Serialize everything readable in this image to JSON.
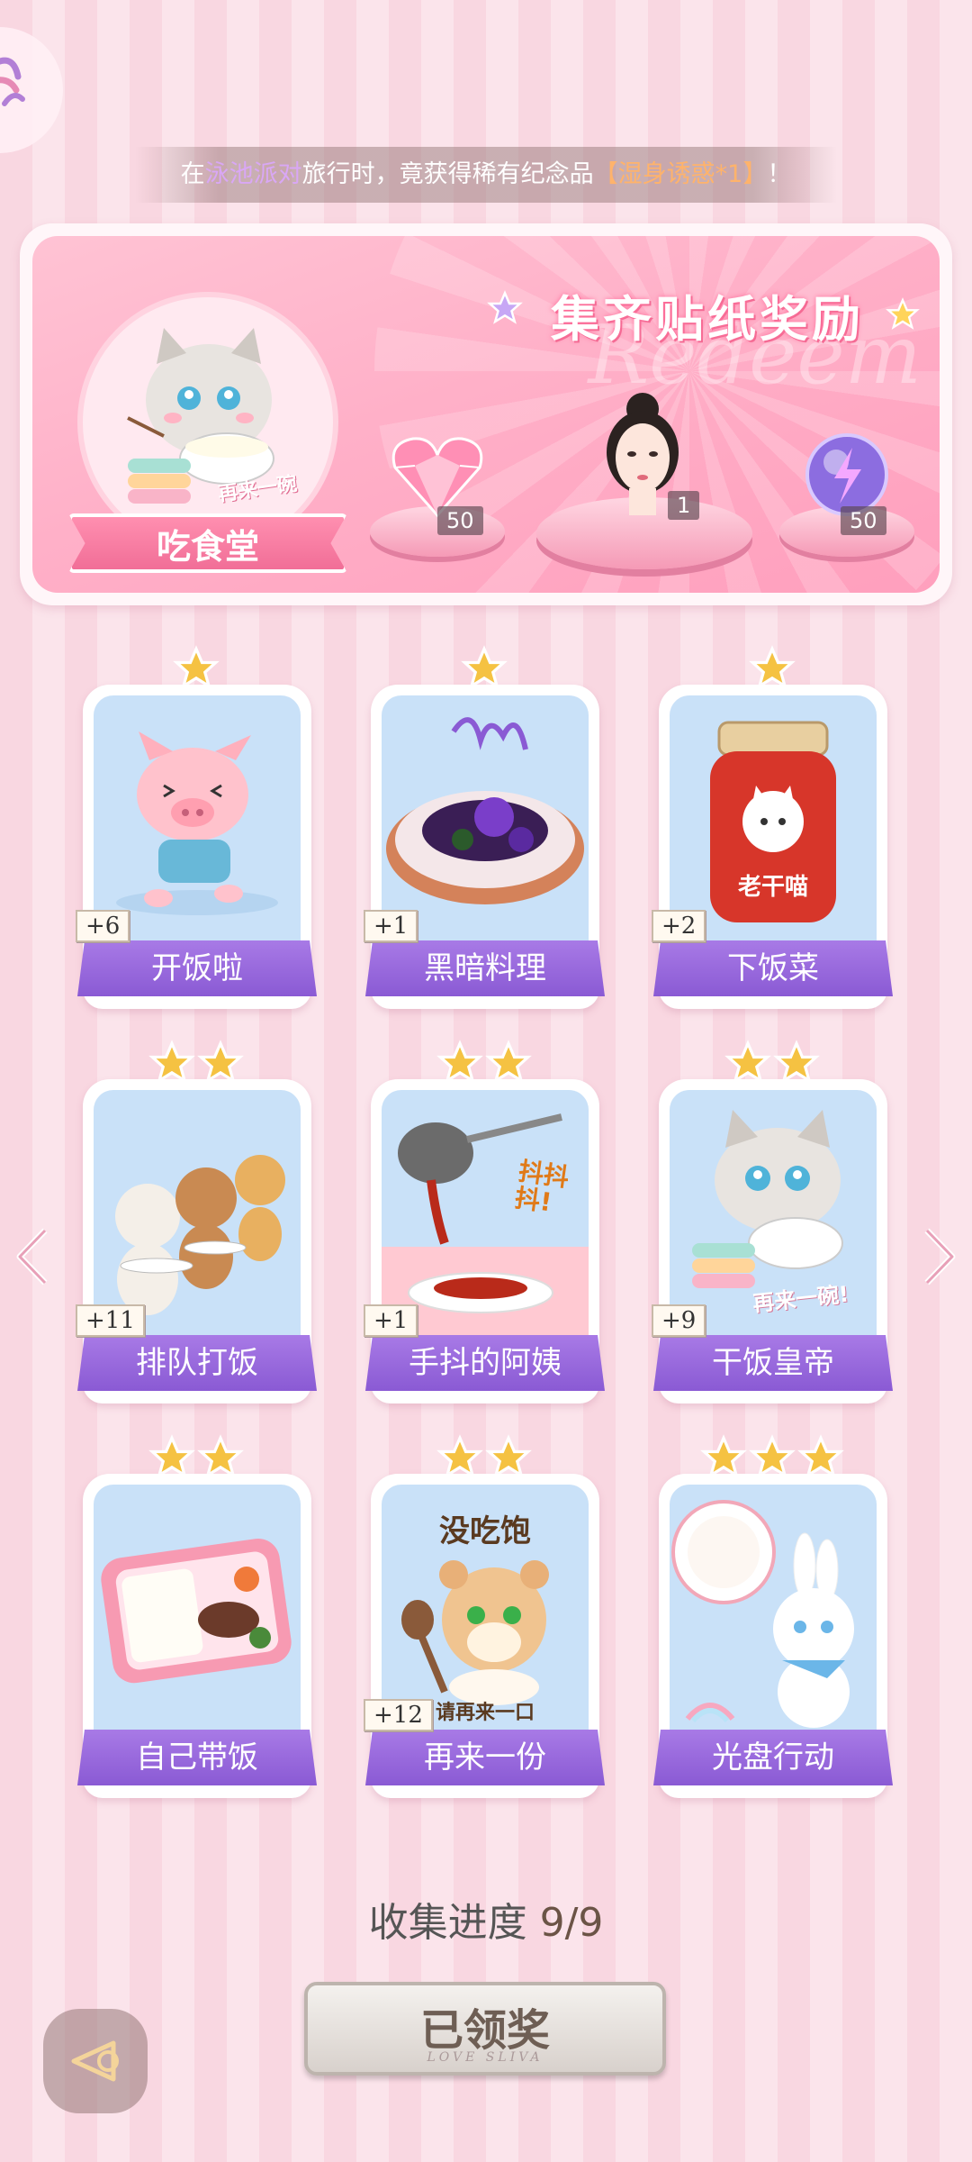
{
  "notice": {
    "prefix": "在",
    "place": "泳池派对",
    "middle": "旅行时，竟获得稀有纪念品",
    "item": "【湿身诱惑*1】",
    "suffix": "！"
  },
  "banner": {
    "title": "集齐贴纸奖励",
    "watermark": "Redeem",
    "album_name": "吃食堂",
    "album_caption": "再来一碗",
    "rewards": [
      {
        "icon": "pink-heart-gem-icon",
        "count": "50"
      },
      {
        "icon": "girl-portrait-icon",
        "count": "1"
      },
      {
        "icon": "purple-energy-orb-icon",
        "count": "50"
      }
    ]
  },
  "stickers": [
    {
      "name": "开饭啦",
      "stars": 1,
      "count": "+6",
      "art": "pig-running-icon"
    },
    {
      "name": "黑暗料理",
      "stars": 1,
      "count": "+1",
      "art": "dark-dish-icon"
    },
    {
      "name": "下饭菜",
      "stars": 1,
      "count": "+2",
      "art": "chili-jar-icon",
      "jar_label": "老干喵"
    },
    {
      "name": "排队打饭",
      "stars": 2,
      "count": "+11",
      "art": "cats-queue-icon"
    },
    {
      "name": "手抖的阿姨",
      "stars": 2,
      "count": "+1",
      "art": "ladle-serving-icon",
      "side_text": "抖抖抖!"
    },
    {
      "name": "干饭皇帝",
      "stars": 2,
      "count": "+9",
      "art": "cat-eating-icon",
      "side_text": "再来一碗!"
    },
    {
      "name": "自己带饭",
      "stars": 2,
      "count": "",
      "art": "bento-box-icon"
    },
    {
      "name": "再来一份",
      "stars": 2,
      "count": "+12",
      "art": "hamster-spoon-icon",
      "top_text": "没吃饱",
      "bottom_text": "请再来一口"
    },
    {
      "name": "光盘行动",
      "stars": 3,
      "count": "",
      "art": "bunny-plate-icon"
    }
  ],
  "progress": {
    "label": "收集进度",
    "value": "9/9"
  },
  "claim_button": {
    "label": "已领奖",
    "sub": "LOVE SLIVA"
  },
  "colors": {
    "card_label": "#8a5ad4",
    "banner_pink": "#ffb0c8",
    "star": "#f5c242"
  }
}
